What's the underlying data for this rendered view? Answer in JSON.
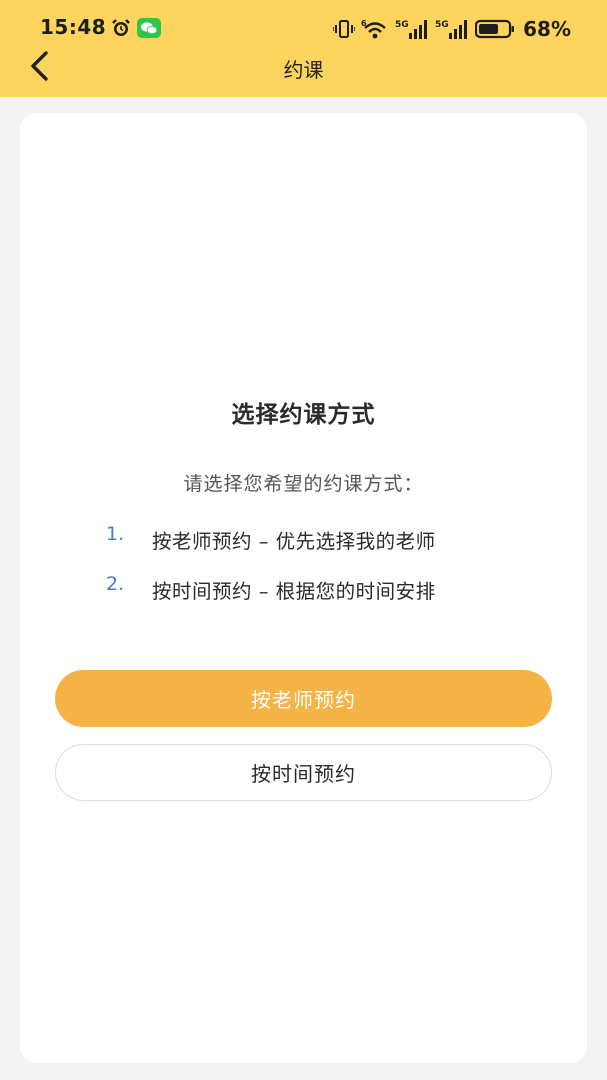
{
  "status_bar": {
    "time": "15:48",
    "battery_percent": "68%",
    "network_1": "5G",
    "network_2": "5G",
    "wifi_badge": "6",
    "icons": [
      "alarm-icon",
      "wechat-icon",
      "vibrate-icon",
      "wifi-icon",
      "signal-icon",
      "battery-icon"
    ],
    "battery_level": 0.68
  },
  "nav": {
    "title": "约课",
    "back_icon": "chevron-left-icon"
  },
  "main": {
    "title": "选择约课方式",
    "subtitle": "请选择您希望的约课方式：",
    "options": [
      {
        "num": "1.",
        "text": "按老师预约 – 优先选择我的老师"
      },
      {
        "num": "2.",
        "text": "按时间预约 – 根据您的时间安排"
      }
    ],
    "primary_button": "按老师预约",
    "secondary_button": "按时间预约"
  },
  "colors": {
    "header_bg": "#fcd45e",
    "primary_button": "#f5b245",
    "number_accent": "#4a7cc7"
  }
}
